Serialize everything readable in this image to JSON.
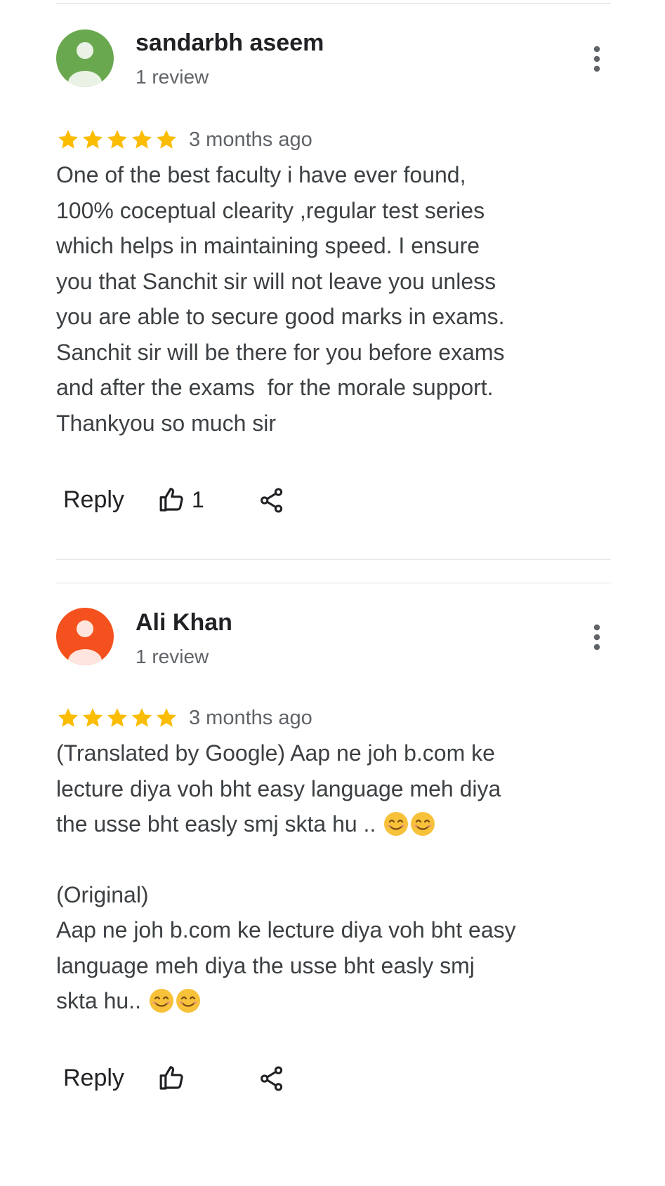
{
  "reviews": [
    {
      "author": "sandarbh aseem",
      "meta": "1 review",
      "avatar_color": "#6aa84f",
      "rating": 5,
      "time": "3 months ago",
      "text": "One of the best faculty i have ever found,\n100% coceptual clearity ,regular test series\nwhich helps in maintaining speed. I ensure\nyou that Sanchit sir will not leave you unless\nyou are able to secure good marks in exams.\nSanchit sir will be there for you before exams\nand after the exams  for the morale support.\nThankyou so much sir",
      "reply_label": "Reply",
      "like_count": "1"
    },
    {
      "author": "Ali Khan",
      "meta": "1 review",
      "avatar_color": "#f4511e",
      "rating": 5,
      "time": "3 months ago",
      "text_translated": "(Translated by Google) Aap ne joh b.com ke\nlecture diya voh bht easy language meh diya\nthe usse bht easly smj skta hu .. ",
      "text_original_label": "(Original)",
      "text_original": "Aap ne joh b.com ke lecture diya voh bht easy\nlanguage meh diya the usse bht easly smj\nskta hu.. ",
      "emoji": "smiling-face-with-smiling-eyes",
      "reply_label": "Reply",
      "like_count": ""
    }
  ],
  "icons": {
    "star": "star-icon",
    "more": "more-vert-icon",
    "like": "thumbs-up-icon",
    "share": "share-icon"
  },
  "colors": {
    "star": "#fbbc04",
    "text": "#3c4043",
    "meta": "#5f6368"
  }
}
